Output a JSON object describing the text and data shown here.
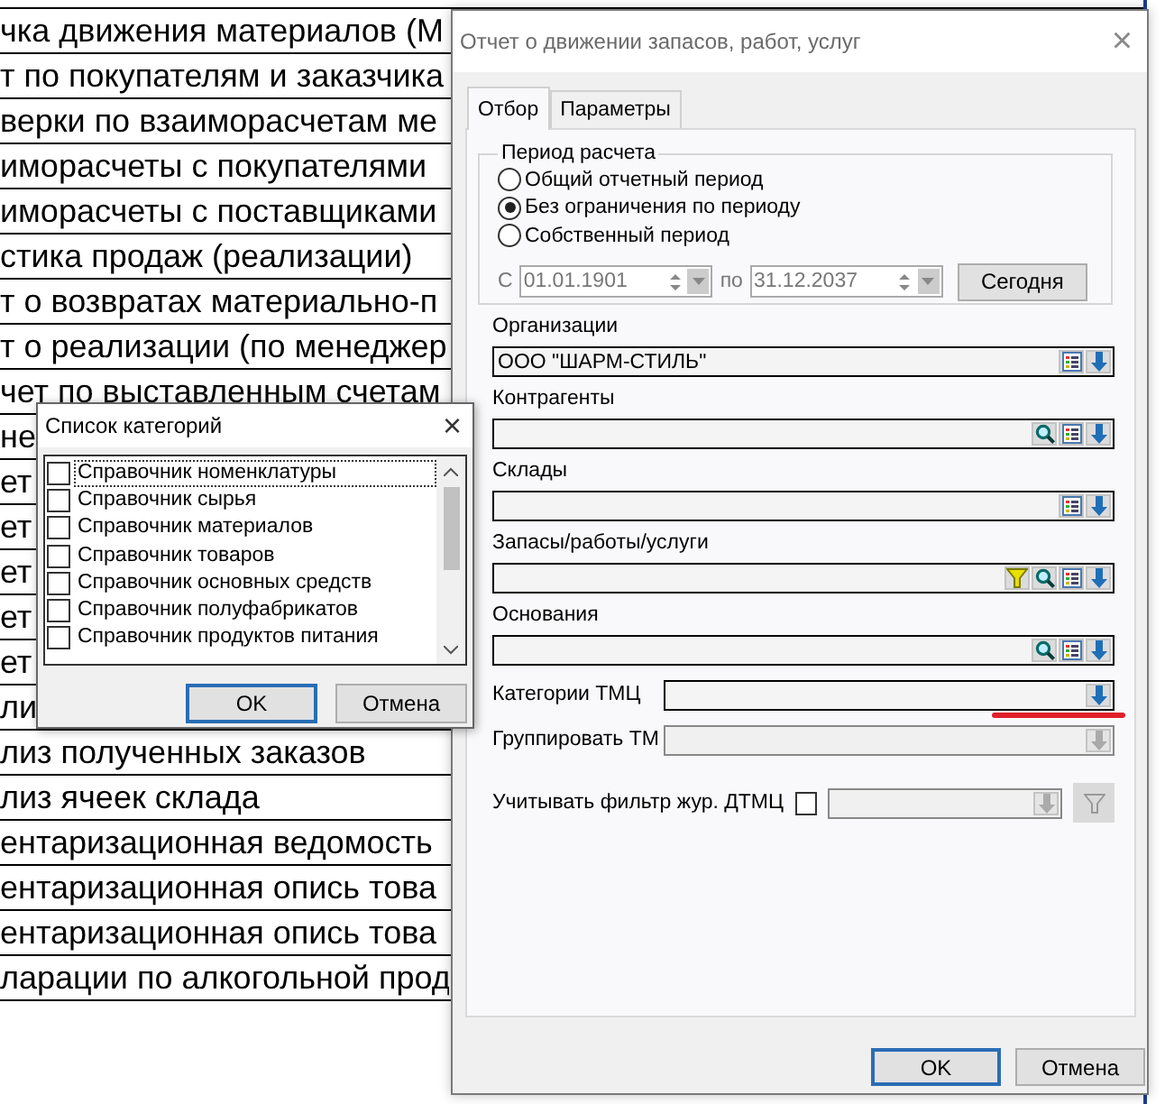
{
  "report_list": {
    "rows": [
      "чка движения материалов (М",
      "т по покупателям и заказчика",
      "верки по взаиморасчетам ме",
      "иморасчеты с покупателями",
      "иморасчеты с поставщиками",
      "стика продаж (реализации)",
      "т о возвратах материально-п",
      "т о реализации (по менеджер",
      "чет по выставленным счетам",
      "не",
      "ет",
      "ет",
      "ет",
      "ет",
      "ет",
      "ли",
      "лиз полученных заказов",
      "лиз ячеек склада",
      "ентаризационная ведомость",
      "ентаризационная опись това",
      "ентаризационная опись това",
      "ларации по алкогольной прод"
    ]
  },
  "report_dialog": {
    "title": "Отчет о движении запасов, работ, услуг",
    "close": "×",
    "tabs": [
      {
        "label": "Отбор",
        "selected": true
      },
      {
        "label": "Параметры",
        "selected": false
      }
    ],
    "period": {
      "title": "Период расчета",
      "options": [
        {
          "label": "Общий отчетный период",
          "selected": false
        },
        {
          "label": "Без ограничения по периоду",
          "selected": true
        },
        {
          "label": "Собственный период",
          "selected": false
        }
      ],
      "from_label": "С",
      "from": "01.01.1901",
      "to_label": "по",
      "to": "31.12.2037",
      "disabled": true,
      "today_button": "Сегодня"
    },
    "fields": [
      {
        "kind": "stacked",
        "label": "Организации",
        "value": "ООО \"ШАРМ-СТИЛЬ\"",
        "buttons": [
          {
            "kind": "list"
          },
          {
            "kind": "dropdown"
          }
        ],
        "disabled": false,
        "underlined": false
      },
      {
        "kind": "stacked",
        "label": "Контрагенты",
        "buttons": [
          {
            "kind": "search"
          },
          {
            "kind": "list"
          },
          {
            "kind": "dropdown"
          }
        ],
        "disabled": false,
        "underlined": false
      },
      {
        "kind": "stacked",
        "label": "Склады",
        "buttons": [
          {
            "kind": "list"
          },
          {
            "kind": "dropdown"
          }
        ],
        "disabled": false,
        "underlined": false
      },
      {
        "kind": "stacked",
        "label": "Запасы/работы/услуги",
        "buttons": [
          {
            "kind": "filter"
          },
          {
            "kind": "search"
          },
          {
            "kind": "list"
          },
          {
            "kind": "dropdown"
          }
        ],
        "disabled": false,
        "underlined": false
      },
      {
        "kind": "stacked",
        "label": "Основания",
        "buttons": [
          {
            "kind": "search"
          },
          {
            "kind": "list"
          },
          {
            "kind": "dropdown"
          }
        ],
        "disabled": false,
        "underlined": false
      },
      {
        "kind": "inline",
        "label": "Категории ТМЦ",
        "buttons": [
          {
            "kind": "dropdown"
          }
        ],
        "disabled": false,
        "underlined": true
      },
      {
        "kind": "inline",
        "label": "Группировать ТМ",
        "buttons": [
          {
            "kind": "dropdown"
          }
        ],
        "disabled": true,
        "underlined": false
      }
    ],
    "journal_filter": {
      "label": "Учитывать фильтр жур. ДТМЦ",
      "checked": false,
      "disabled": true
    },
    "buttons": [
      {
        "label": "OK",
        "default": true
      },
      {
        "label": "Отмена",
        "default": false
      }
    ]
  },
  "category_dialog": {
    "title": "Список категорий",
    "close": "×",
    "items": [
      {
        "label": "Справочник номенклатуры",
        "checked": false,
        "focused": true
      },
      {
        "label": "Справочник сырья",
        "checked": false,
        "focused": false
      },
      {
        "label": "Справочник материалов",
        "checked": false,
        "focused": false
      },
      {
        "label": "Справочник товаров",
        "checked": false,
        "focused": false
      },
      {
        "label": "Справочник основных средств",
        "checked": false,
        "focused": false
      },
      {
        "label": "Справочник полуфабрикатов",
        "checked": false,
        "focused": false
      },
      {
        "label": "Справочник продуктов питания",
        "checked": false,
        "focused": false
      }
    ],
    "buttons": [
      {
        "label": "OK",
        "default": true
      },
      {
        "label": "Отмена",
        "default": false
      }
    ]
  }
}
